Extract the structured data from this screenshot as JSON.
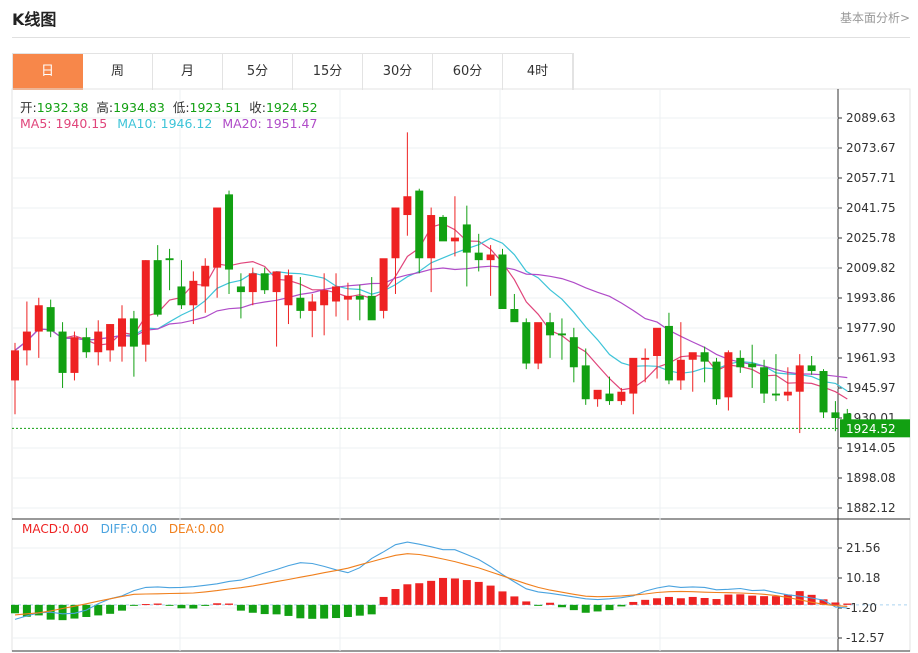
{
  "header": {
    "title": "K线图",
    "fundamental_link": "基本面分析>"
  },
  "tabs": [
    "日",
    "周",
    "月",
    "5分",
    "15分",
    "30分",
    "60分",
    "4时"
  ],
  "active_tab": 0,
  "ohlc": {
    "open_label": "开:",
    "open": "1932.38",
    "high_label": "高:",
    "high": "1934.83",
    "low_label": "低:",
    "low": "1923.51",
    "close_label": "收:",
    "close": "1924.52"
  },
  "ma": {
    "ma5_label": "MA5:",
    "ma5": "1940.15",
    "ma10_label": "MA10:",
    "ma10": "1946.12",
    "ma20_label": "MA20:",
    "ma20": "1951.47"
  },
  "macd": {
    "macd_label": "MACD:",
    "macd": "0.00",
    "diff_label": "DIFF:",
    "diff": "0.00",
    "dea_label": "DEA:",
    "dea": "0.00"
  },
  "colors": {
    "up": "#ee2222",
    "down": "#12a012",
    "ma5": "#e0457b",
    "ma10": "#3ec4d8",
    "ma20": "#b04cc8",
    "diff": "#4aa3df",
    "dea": "#f07f1c",
    "accent": "#f7874a"
  },
  "last_price_tag": "1924.52",
  "chart_data": {
    "type": "candlestick",
    "price_axis_ticks": [
      "2089.63",
      "2073.67",
      "2057.71",
      "2041.75",
      "2025.78",
      "2009.82",
      "1993.86",
      "1977.90",
      "1961.93",
      "1945.97",
      "1930.01",
      "1914.05",
      "1898.08",
      "1882.12"
    ],
    "macd_axis_ticks": [
      "21.56",
      "10.18",
      "-1.20",
      "-12.57"
    ],
    "candles": [
      [
        1950,
        1970,
        1932,
        1966
      ],
      [
        1966,
        1992,
        1958,
        1976
      ],
      [
        1976,
        1994,
        1962,
        1990
      ],
      [
        1989,
        1993,
        1973,
        1976
      ],
      [
        1976,
        1981,
        1946,
        1954
      ],
      [
        1954,
        1976,
        1950,
        1973
      ],
      [
        1973,
        1978,
        1962,
        1965
      ],
      [
        1965,
        1982,
        1958,
        1976
      ],
      [
        1966,
        1980,
        1960,
        1980
      ],
      [
        1968,
        1990,
        1960,
        1983
      ],
      [
        1983,
        1987,
        1952,
        1968
      ],
      [
        1969,
        2014,
        1960,
        2014
      ],
      [
        2014,
        2022,
        1984,
        1985
      ],
      [
        2015,
        2020,
        1998,
        2014
      ],
      [
        2000,
        2014,
        1988,
        1990
      ],
      [
        1990,
        2008,
        1980,
        2003
      ],
      [
        2000,
        2015,
        1986,
        2011
      ],
      [
        2010,
        2033,
        1994,
        2042
      ],
      [
        2049,
        2051,
        1996,
        2009
      ],
      [
        2000,
        2007,
        1983,
        1997
      ],
      [
        1997,
        2010,
        1990,
        2007
      ],
      [
        2007,
        2010,
        1996,
        1998
      ],
      [
        1997,
        2008,
        1968,
        2008
      ],
      [
        1990,
        2009,
        1980,
        2006
      ],
      [
        1994,
        2005,
        1983,
        1987
      ],
      [
        1987,
        1996,
        1973,
        1992
      ],
      [
        1990,
        2007,
        1974,
        1998
      ],
      [
        1992,
        2007,
        1984,
        2000
      ],
      [
        1993,
        2002,
        1982,
        1995
      ],
      [
        1995,
        2001,
        1982,
        1993
      ],
      [
        1995,
        2005,
        1985,
        1982
      ],
      [
        1987,
        2007,
        1983,
        2015
      ],
      [
        2015,
        2042,
        1996,
        2042
      ],
      [
        2038,
        2082,
        2027,
        2048
      ],
      [
        2051,
        2052,
        2007,
        2015
      ],
      [
        2015,
        2042,
        1997,
        2038
      ],
      [
        2037,
        2038,
        2025,
        2024
      ],
      [
        2024,
        2048,
        2016,
        2026
      ],
      [
        2033,
        2043,
        2000,
        2018
      ],
      [
        2018,
        2028,
        2008,
        2014
      ],
      [
        2014,
        2022,
        1995,
        2017
      ],
      [
        2017,
        2020,
        1988,
        1988
      ],
      [
        1988,
        1996,
        1983,
        1981
      ],
      [
        1981,
        1983,
        1956,
        1959
      ],
      [
        1959,
        1965,
        1956,
        1981
      ],
      [
        1981,
        1986,
        1962,
        1974
      ],
      [
        1975,
        1983,
        1961,
        1974
      ],
      [
        1973,
        1978,
        1949,
        1957
      ],
      [
        1958,
        1967,
        1937,
        1940
      ],
      [
        1940,
        1942,
        1936,
        1945
      ],
      [
        1943,
        1952,
        1937,
        1939
      ],
      [
        1939,
        1946,
        1937,
        1944
      ],
      [
        1943,
        1961,
        1932,
        1962
      ],
      [
        1961,
        1967,
        1949,
        1962
      ],
      [
        1963,
        1974,
        1951,
        1978
      ],
      [
        1979,
        1986,
        1948,
        1950
      ],
      [
        1950,
        1981,
        1945,
        1961
      ],
      [
        1961,
        1964,
        1944,
        1965
      ],
      [
        1965,
        1968,
        1949,
        1960
      ],
      [
        1960,
        1962,
        1937,
        1940
      ],
      [
        1941,
        1966,
        1934,
        1965
      ],
      [
        1962,
        1966,
        1954,
        1957
      ],
      [
        1959,
        1969,
        1946,
        1957
      ],
      [
        1957,
        1961,
        1938,
        1943
      ],
      [
        1943,
        1964,
        1939,
        1942
      ],
      [
        1942,
        1957,
        1939,
        1944
      ],
      [
        1944,
        1964,
        1922,
        1958
      ],
      [
        1958,
        1963,
        1953,
        1955
      ],
      [
        1955,
        1956,
        1930,
        1933
      ],
      [
        1933,
        1939,
        1923,
        1930
      ],
      [
        1932.38,
        1934.83,
        1923.51,
        1924.52
      ]
    ],
    "macd_bars": [
      -3.2,
      -4.5,
      -4.0,
      -5.6,
      -5.8,
      -5.2,
      -4.6,
      -4.0,
      -3.4,
      -2.2,
      -0.3,
      0.3,
      0.5,
      -0.2,
      -1.3,
      -1.4,
      -0.4,
      0.6,
      0.5,
      -2.2,
      -3.0,
      -3.5,
      -3.6,
      -4.2,
      -5.1,
      -5.3,
      -5.2,
      -5.0,
      -4.6,
      -4.1,
      -3.6,
      3.0,
      6.0,
      7.8,
      8.2,
      9.1,
      10.2,
      10.0,
      9.4,
      8.7,
      7.3,
      5.1,
      3.2,
      1.3,
      -0.3,
      0.8,
      -0.9,
      -2.0,
      -3.0,
      -2.5,
      -2.0,
      -0.6,
      1.1,
      1.9,
      2.5,
      3.0,
      2.5,
      3.0,
      2.6,
      2.2,
      3.9,
      4.0,
      3.5,
      3.3,
      3.3,
      3.9,
      5.2,
      3.8,
      2.1,
      0.9,
      0.5
    ],
    "diff": [
      -5.5,
      -4.2,
      -3.0,
      -2.8,
      -3.4,
      -3.2,
      -2.0,
      0.4,
      2.3,
      3.4,
      5.4,
      6.6,
      6.8,
      6.5,
      6.6,
      6.9,
      7.4,
      8.0,
      8.9,
      9.4,
      10.7,
      12.1,
      13.4,
      14.9,
      16.0,
      15.7,
      14.6,
      13.3,
      12.2,
      14.1,
      17.6,
      20.1,
      22.8,
      23.8,
      23.0,
      22.0,
      20.9,
      20.9,
      19.1,
      17.2,
      14.5,
      11.5,
      8.7,
      6.1,
      4.9,
      4.4,
      3.7,
      3.0,
      2.3,
      2.0,
      2.3,
      2.7,
      3.4,
      5.2,
      6.4,
      7.2,
      6.6,
      6.8,
      6.6,
      5.7,
      5.9,
      6.2,
      5.4,
      5.6,
      4.6,
      3.8,
      3.3,
      2.6,
      1.8,
      -0.8,
      -1.2
    ],
    "dea": [
      -3.8,
      -3.4,
      -3.0,
      -2.3,
      -1.4,
      -0.5,
      0.4,
      1.4,
      2.3,
      3.2,
      4.0,
      4.1,
      4.2,
      4.3,
      4.4,
      4.5,
      4.9,
      5.4,
      6.0,
      6.5,
      7.2,
      8.0,
      8.8,
      9.6,
      10.5,
      11.3,
      12.2,
      13.0,
      13.9,
      15.2,
      16.4,
      17.6,
      18.8,
      19.4,
      19.1,
      18.3,
      17.4,
      16.4,
      15.2,
      14.0,
      12.5,
      11.0,
      9.5,
      8.0,
      6.6,
      5.6,
      4.8,
      4.0,
      3.3,
      3.1,
      3.2,
      3.4,
      3.7,
      4.1,
      4.7,
      5.0,
      5.1,
      5.0,
      4.8,
      4.7,
      4.6,
      4.5,
      4.3,
      4.0,
      3.5,
      2.8,
      1.9,
      1.0,
      0.2,
      -0.3,
      -0.6
    ]
  }
}
